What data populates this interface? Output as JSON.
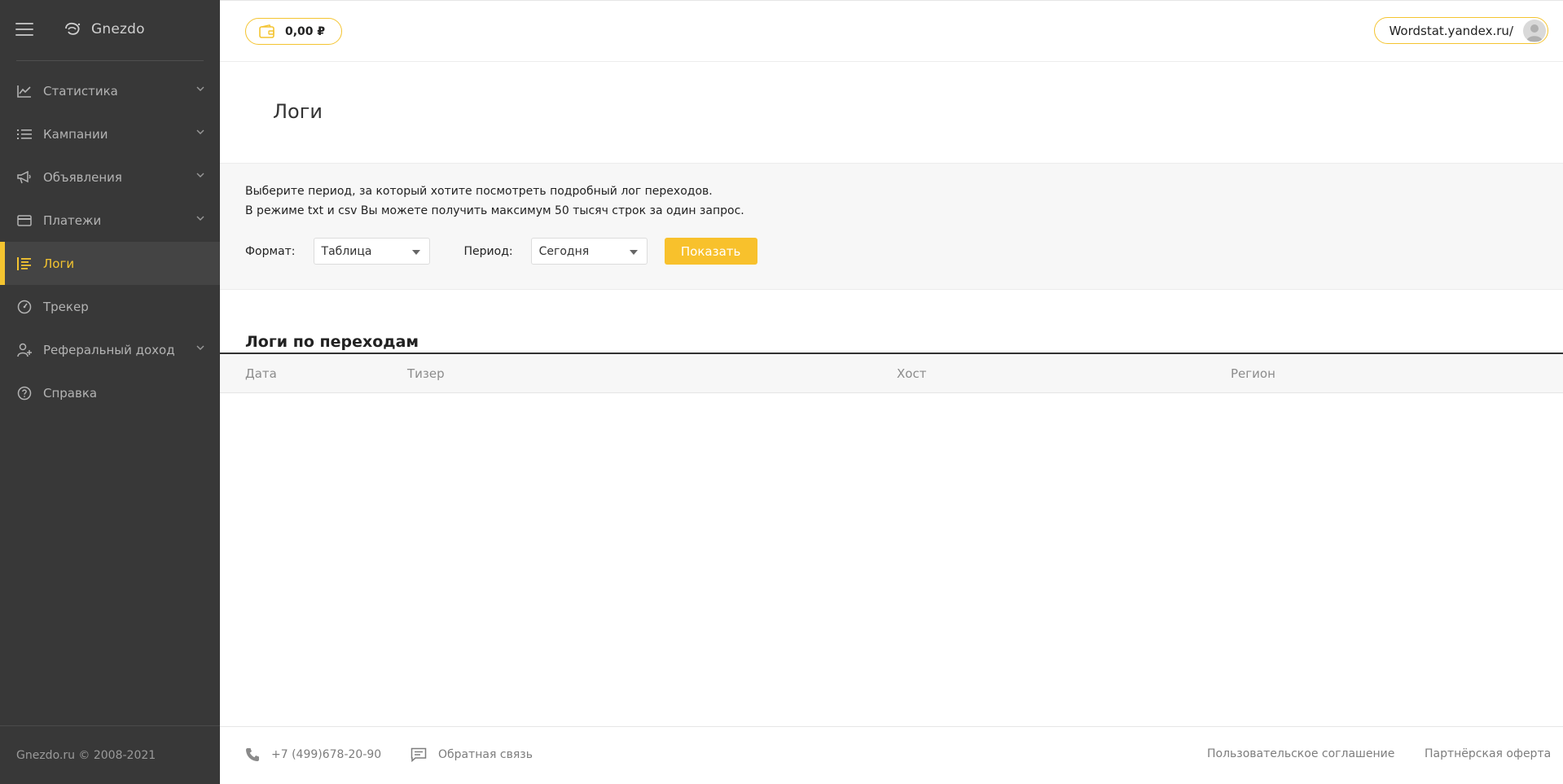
{
  "sidebar": {
    "brand": "Gnezdo",
    "items": [
      {
        "label": "Статистика"
      },
      {
        "label": "Кампании"
      },
      {
        "label": "Объявления"
      },
      {
        "label": "Платежи"
      },
      {
        "label": "Логи"
      },
      {
        "label": "Трекер"
      },
      {
        "label": "Реферальный доход"
      },
      {
        "label": "Справка"
      }
    ],
    "copyright": "Gnezdo.ru © 2008-2021"
  },
  "topbar": {
    "balance": "0,00 ₽",
    "site": "Wordstat.yandex.ru/"
  },
  "page": {
    "title": "Логи"
  },
  "filter": {
    "line1": "Выберите период, за который хотите посмотреть подробный лог переходов.",
    "line2": "В режиме txt и csv Вы можете получить максимум 50 тысяч строк за один запрос.",
    "format_label": "Формат:",
    "format_value": "Таблица",
    "period_label": "Период:",
    "period_value": "Сегодня",
    "show_button": "Показать"
  },
  "logs": {
    "title": "Логи по переходам",
    "columns": [
      "Дата",
      "Тизер",
      "Хост",
      "Регион"
    ]
  },
  "footer": {
    "phone": "+7 (499)678-20-90",
    "feedback": "Обратная связь",
    "agreement": "Пользовательское соглашение",
    "offer": "Партнёрская оферта"
  },
  "colors": {
    "accent": "#f4c430",
    "sidebar_bg": "#383838"
  }
}
